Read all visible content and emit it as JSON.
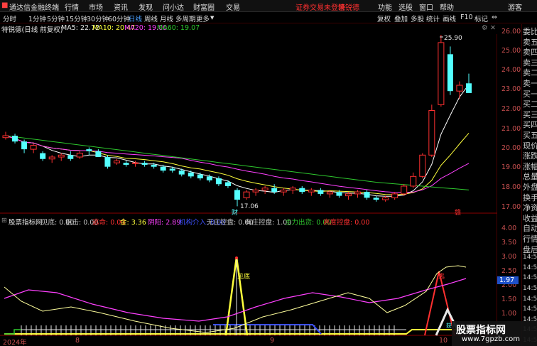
{
  "topbar": {
    "app_title": "通达信金融终端",
    "menus": [
      "行情",
      "市场",
      "资讯",
      "发现",
      "问小达",
      "财富圈",
      "交易"
    ],
    "login_status": "证券交易未登录",
    "stock_tab": "特锐德",
    "right_menus": [
      "功能",
      "选股",
      "窗口",
      "帮助"
    ],
    "guest": "游客"
  },
  "periodbar": {
    "periods": [
      "分时",
      "1分钟",
      "5分钟",
      "15分钟",
      "30分钟",
      "60分钟",
      "日线",
      "周线",
      "月线",
      "多周期",
      "更多"
    ],
    "active_period": "日线",
    "tools": [
      "复权",
      "叠加",
      "多股",
      "统计",
      "画线",
      "F10",
      "标记"
    ],
    "more_arrow": "▼"
  },
  "infobar": {
    "title": "特锐德(日线 前复权)",
    "ma5": "MA5: 22.72",
    "ma10": "MA10: 20.47",
    "ma20": "MA20: 19.00",
    "ma60": "MA60: 19.07"
  },
  "indbar": {
    "name": "股票指标网",
    "items": [
      {
        "label": "见底: 0.00",
        "color": "#ffffff"
      },
      {
        "label": "狙击: 0.00",
        "color": "#ffffff"
      },
      {
        "label": "逃命: 0.00",
        "color": "#ff3030"
      },
      {
        "label": "金: 3.36",
        "color": "#ffff3c"
      },
      {
        "label": "阴阳: 2.89",
        "color": "#ff40ff"
      },
      {
        "label": "机构介入: 0.00",
        "color": "#3c50ff"
      },
      {
        "label": "无庄控盘: 0.00",
        "color": "#ffffff"
      },
      {
        "label": "有庄控盘: 1.00",
        "color": "#ffffff"
      },
      {
        "label": "主力出货: 0.00",
        "color": "#2ec82e"
      },
      {
        "label": "高度控盘: 0.00",
        "color": "#ff3030"
      }
    ]
  },
  "price_axis": [
    "26.00",
    "25.00",
    "24.00",
    "23.00",
    "22.00",
    "21.00",
    "20.00",
    "19.00",
    "18.00",
    "17.00"
  ],
  "ind_axis": [
    "4.00",
    "3.50",
    "3.00",
    "2.50",
    "2.00",
    "1.50",
    "1.00"
  ],
  "ind_marker": "1.97",
  "annotations": {
    "high": "25.90",
    "low": "17.06",
    "cai": "财",
    "fu": "赣",
    "jiandi": "见底",
    "tao": "逃",
    "huoli": "获利"
  },
  "date_axis": [
    "2024年",
    "8",
    "9",
    "10"
  ],
  "sidebar": [
    "委比",
    "卖五",
    "卖四",
    "卖三",
    "卖二",
    "卖一",
    "买一",
    "买二",
    "买三",
    "买四",
    "买五",
    "现价",
    "涨跌",
    "涨幅",
    "总量",
    "外盘",
    "换手",
    "净资",
    "收益",
    "自动",
    "行情",
    "盘后",
    "14:50",
    "14:50",
    "14:50",
    "14:50",
    "14:50",
    "14:50",
    "14:50",
    "14:50",
    "14:50"
  ],
  "watermark": {
    "title": "股票指标网",
    "url": "www.7gpzb.com"
  },
  "chart_data": {
    "type": "candlestick",
    "ylim": [
      16.8,
      26.3
    ],
    "candles": [
      [
        20.6,
        20.9,
        20.5,
        20.7
      ],
      [
        20.7,
        20.8,
        20.3,
        20.4
      ],
      [
        20.4,
        20.5,
        19.8,
        20.0
      ],
      [
        20.0,
        20.3,
        19.8,
        20.2
      ],
      [
        19.8,
        19.9,
        19.4,
        19.5
      ],
      [
        19.5,
        19.7,
        19.3,
        19.6
      ],
      [
        19.6,
        19.8,
        19.4,
        19.7
      ],
      [
        19.7,
        19.9,
        19.4,
        19.5
      ],
      [
        19.6,
        19.9,
        19.5,
        19.8
      ],
      [
        20.0,
        20.1,
        19.7,
        19.9
      ],
      [
        19.9,
        20.0,
        19.6,
        19.6
      ],
      [
        19.6,
        19.7,
        19.0,
        19.1
      ],
      [
        19.3,
        19.5,
        19.2,
        19.4
      ],
      [
        19.3,
        19.4,
        19.1,
        19.2
      ],
      [
        19.3,
        19.4,
        19.1,
        19.3
      ],
      [
        19.3,
        19.4,
        19.1,
        19.2
      ],
      [
        19.2,
        19.3,
        19.0,
        19.1
      ],
      [
        19.1,
        19.2,
        18.8,
        18.9
      ],
      [
        19.0,
        19.1,
        18.8,
        18.9
      ],
      [
        18.9,
        19.0,
        18.6,
        18.7
      ],
      [
        18.8,
        18.9,
        18.5,
        18.6
      ],
      [
        18.7,
        18.8,
        18.4,
        18.5
      ],
      [
        18.6,
        18.7,
        18.3,
        18.4
      ],
      [
        18.5,
        18.6,
        18.1,
        18.2
      ],
      [
        18.3,
        18.4,
        18.0,
        18.1
      ],
      [
        17.9,
        18.0,
        17.06,
        17.4
      ],
      [
        17.5,
        17.9,
        17.4,
        17.8
      ],
      [
        17.8,
        18.0,
        17.6,
        17.9
      ],
      [
        17.9,
        18.1,
        17.7,
        18.0
      ],
      [
        18.0,
        18.2,
        17.7,
        17.8
      ],
      [
        17.8,
        18.0,
        17.6,
        17.9
      ],
      [
        17.9,
        18.1,
        17.7,
        18.0
      ],
      [
        18.0,
        18.1,
        17.7,
        17.8
      ],
      [
        17.8,
        18.0,
        17.6,
        17.9
      ],
      [
        17.9,
        18.0,
        17.6,
        17.7
      ],
      [
        17.7,
        17.9,
        17.5,
        17.8
      ],
      [
        17.8,
        17.9,
        17.5,
        17.6
      ],
      [
        17.6,
        17.8,
        17.4,
        17.7
      ],
      [
        17.7,
        17.9,
        17.5,
        17.8
      ],
      [
        17.8,
        17.9,
        17.4,
        17.5
      ],
      [
        17.5,
        17.6,
        17.3,
        17.4
      ],
      [
        17.4,
        17.6,
        17.3,
        17.5
      ],
      [
        17.5,
        17.8,
        17.4,
        17.7
      ],
      [
        17.7,
        18.2,
        17.6,
        18.1
      ],
      [
        18.1,
        18.8,
        18.0,
        18.6
      ],
      [
        18.6,
        19.8,
        18.5,
        19.7
      ],
      [
        19.7,
        22.3,
        19.6,
        22.0
      ],
      [
        22.3,
        25.9,
        22.2,
        25.5
      ],
      [
        24.9,
        25.3,
        22.8,
        23.0
      ],
      [
        23.0,
        23.5,
        22.6,
        23.3
      ],
      [
        23.4,
        23.9,
        22.9,
        22.9
      ]
    ]
  }
}
